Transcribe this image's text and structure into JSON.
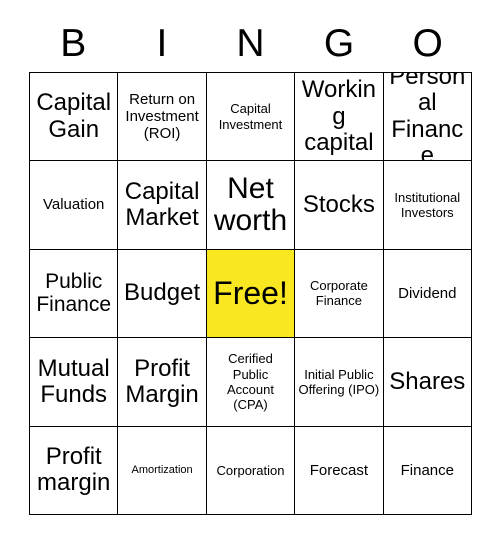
{
  "card": {
    "title_letters": [
      "B",
      "I",
      "N",
      "G",
      "O"
    ],
    "free_space_color": "#F9E821",
    "grid_line_color": "#000000",
    "background_color": "#FFFFFF",
    "columns": 5,
    "rows": 5,
    "cells": [
      {
        "text": "Capital Gain",
        "size": "xl",
        "free": false
      },
      {
        "text": "Return on Investment (ROI)",
        "size": "m",
        "free": false
      },
      {
        "text": "Capital Investment",
        "size": "s",
        "free": false
      },
      {
        "text": "Working capital",
        "size": "xl",
        "free": false
      },
      {
        "text": "Personal Finance",
        "size": "xl",
        "free": false
      },
      {
        "text": "Valuation",
        "size": "m",
        "free": false
      },
      {
        "text": "Capital Market",
        "size": "xl",
        "free": false
      },
      {
        "text": "Net worth",
        "size": "xxl",
        "free": false
      },
      {
        "text": "Stocks",
        "size": "xl",
        "free": false
      },
      {
        "text": "Institutional Investors",
        "size": "s",
        "free": false
      },
      {
        "text": "Public Finance",
        "size": "l",
        "free": false
      },
      {
        "text": "Budget",
        "size": "xl",
        "free": false
      },
      {
        "text": "Free!",
        "size": "xxl",
        "free": true
      },
      {
        "text": "Corporate Finance",
        "size": "s",
        "free": false
      },
      {
        "text": "Dividend",
        "size": "m",
        "free": false
      },
      {
        "text": "Mutual Funds",
        "size": "xl",
        "free": false
      },
      {
        "text": "Profit Margin",
        "size": "xl",
        "free": false
      },
      {
        "text": "Cerified Public Account (CPA)",
        "size": "s",
        "free": false
      },
      {
        "text": "Initial Public Offering (IPO)",
        "size": "s",
        "free": false
      },
      {
        "text": "Shares",
        "size": "xl",
        "free": false
      },
      {
        "text": "Profit margin",
        "size": "xl",
        "free": false
      },
      {
        "text": "Amortization",
        "size": "xs",
        "free": false
      },
      {
        "text": "Corporation",
        "size": "s",
        "free": false
      },
      {
        "text": "Forecast",
        "size": "m",
        "free": false
      },
      {
        "text": "Finance",
        "size": "m",
        "free": false
      }
    ]
  }
}
